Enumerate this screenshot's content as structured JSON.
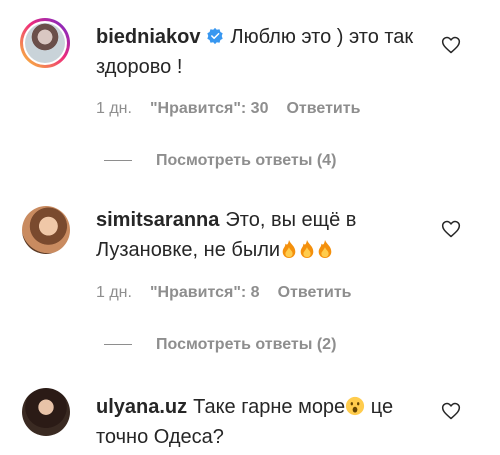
{
  "comments": [
    {
      "username": "biedniakov",
      "verified": true,
      "text": "Люблю это ) это так здорово !",
      "time": "1 дн.",
      "likes": "\"Нравится\": 30",
      "reply": "Ответить",
      "view_replies": "Посмотреть ответы (4)"
    },
    {
      "username": "simitsaranna",
      "text": "Это, вы ещё в Лузановке, не были",
      "text_emoji": "fire-fire-fire",
      "time": "1 дн.",
      "likes": "\"Нравится\": 8",
      "reply": "Ответить",
      "view_replies": "Посмотреть ответы (2)"
    },
    {
      "username": "ulyana.uz",
      "text_before": "Таке гарне море",
      "text_emoji": "surprised-face",
      "text_after": " це точно Одеса?"
    }
  ],
  "icons": {
    "like": "heart-icon",
    "verified": "verified-badge-icon",
    "fire": "fire-emoji",
    "surprised": "surprised-face-emoji"
  },
  "colors": {
    "text": "#262626",
    "meta": "#8e8e8e",
    "verified": "#3897f0",
    "ring_start": "#f9ce34",
    "ring_mid": "#ee2a7b",
    "ring_end": "#6228d7"
  }
}
